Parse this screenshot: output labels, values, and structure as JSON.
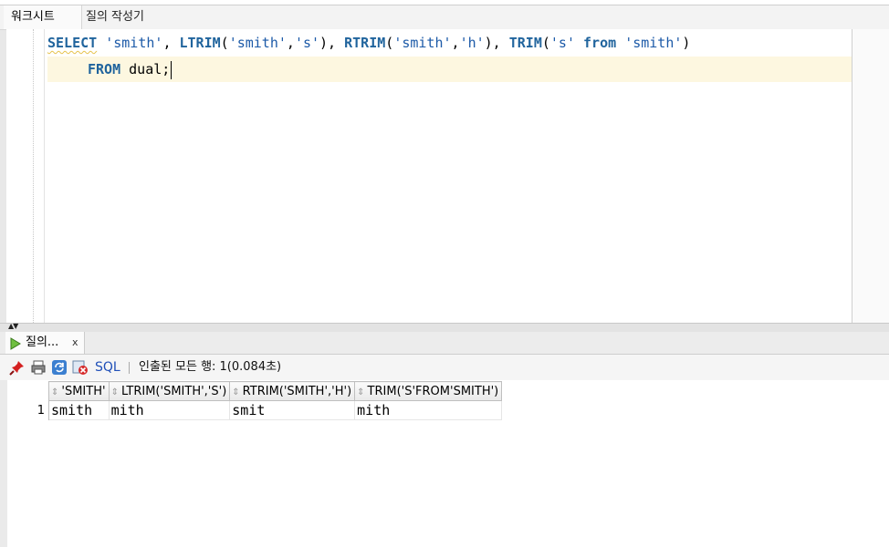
{
  "tabs": {
    "worksheet": "워크시트",
    "query_builder": "질의 작성기"
  },
  "editor": {
    "line1": [
      {
        "t": "SELECT",
        "c": "kw squig"
      },
      {
        "t": " ",
        "c": "plain"
      },
      {
        "t": "'smith'",
        "c": "str"
      },
      {
        "t": ", ",
        "c": "plain"
      },
      {
        "t": "LTRIM",
        "c": "kw"
      },
      {
        "t": "(",
        "c": "plain"
      },
      {
        "t": "'smith'",
        "c": "str"
      },
      {
        "t": ",",
        "c": "plain"
      },
      {
        "t": "'s'",
        "c": "str"
      },
      {
        "t": "), ",
        "c": "plain"
      },
      {
        "t": "RTRIM",
        "c": "kw"
      },
      {
        "t": "(",
        "c": "plain"
      },
      {
        "t": "'smith'",
        "c": "str"
      },
      {
        "t": ",",
        "c": "plain"
      },
      {
        "t": "'h'",
        "c": "str"
      },
      {
        "t": "), ",
        "c": "plain"
      },
      {
        "t": "TRIM",
        "c": "kw"
      },
      {
        "t": "(",
        "c": "plain"
      },
      {
        "t": "'s'",
        "c": "str"
      },
      {
        "t": " ",
        "c": "plain"
      },
      {
        "t": "from",
        "c": "kw"
      },
      {
        "t": " ",
        "c": "plain"
      },
      {
        "t": "'smith'",
        "c": "str"
      },
      {
        "t": ")",
        "c": "plain"
      }
    ],
    "line2": [
      {
        "t": "FROM",
        "c": "kw"
      },
      {
        "t": " dual;",
        "c": "plain"
      }
    ]
  },
  "result": {
    "tab_label": "질의...",
    "close_label": "x",
    "sql_label": "SQL",
    "status": "인출된 모든 행: 1(0.084초)",
    "columns": [
      "'SMITH'",
      "LTRIM('SMITH','S')",
      "RTRIM('SMITH','H')",
      "TRIM('S'FROM'SMITH')"
    ],
    "rows": [
      {
        "num": "1",
        "cells": [
          "smith",
          "mith",
          "smit",
          "mith"
        ]
      }
    ]
  }
}
